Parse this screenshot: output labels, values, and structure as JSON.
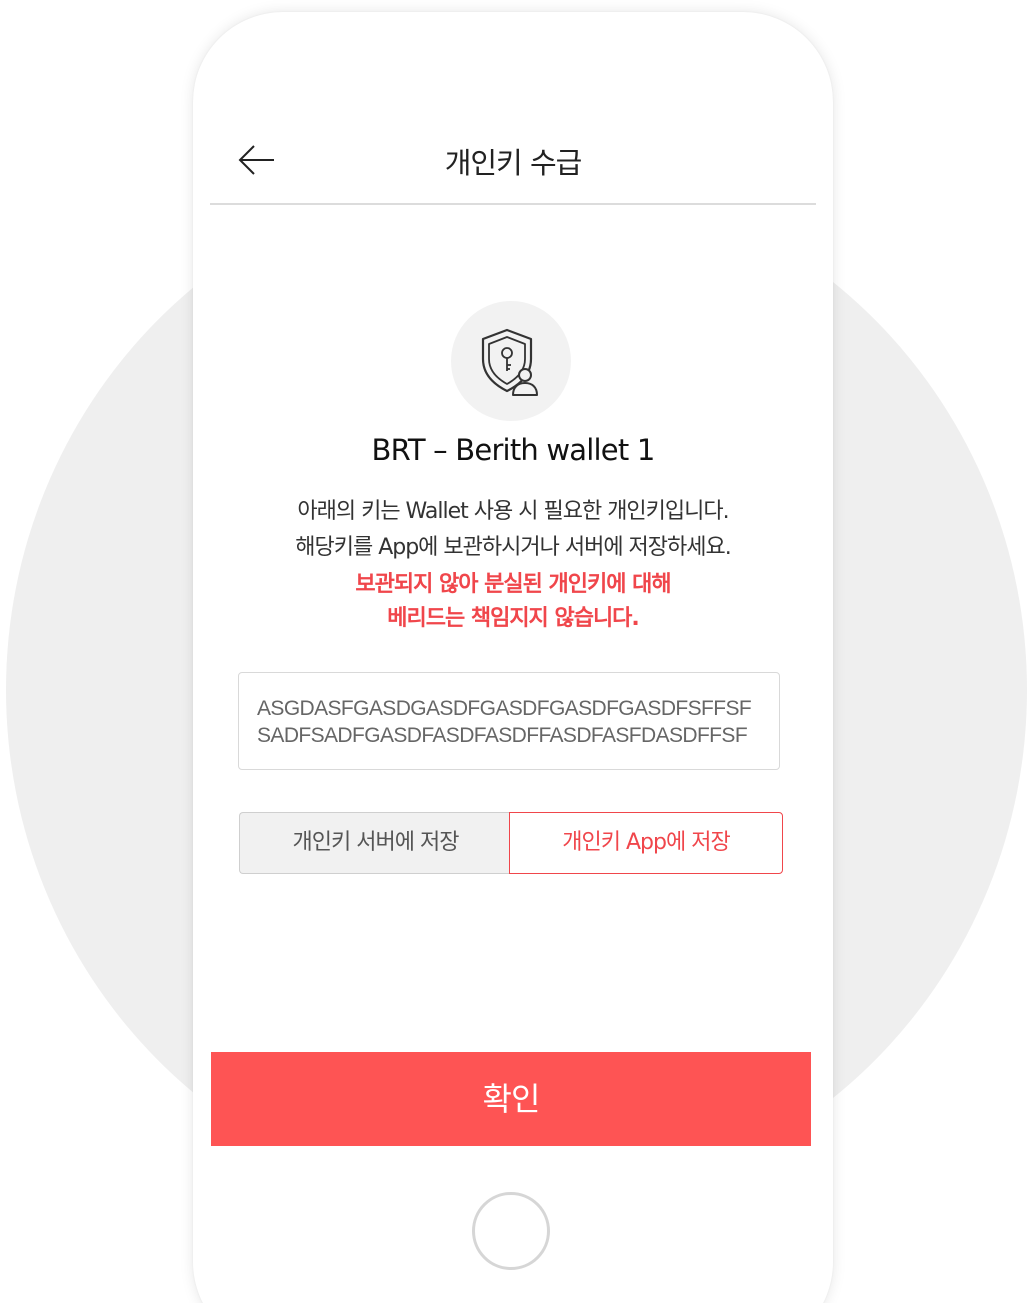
{
  "header": {
    "title": "개인키 수급",
    "back_icon": "arrow-left-icon"
  },
  "wallet": {
    "icon": "shield-key-user-icon",
    "name": "BRT – Berith wallet 1"
  },
  "description": {
    "line1": "아래의 키는 Wallet 사용 시 필요한 개인키입니다.",
    "line2": "해당키를 App에 보관하시거나 서버에 저장하세요."
  },
  "warning": {
    "line1": "보관되지 않아 분실된 개인키에 대해",
    "line2": "베리드는 책임지지 않습니다."
  },
  "private_key": {
    "line1": "ASGDASFGASDGASDFGASDFGASDFGASDFSFFSF",
    "line2": "SADFSADFGASDFASDFASDFFASDFASFDASDFFSF"
  },
  "save_options": {
    "server_label": "개인키 서버에 저장",
    "app_label": "개인키 App에 저장",
    "selected": "app"
  },
  "confirm_label": "확인",
  "colors": {
    "accent": "#fe5454",
    "warning_text": "#f0464b",
    "background_circle": "#efefef"
  }
}
